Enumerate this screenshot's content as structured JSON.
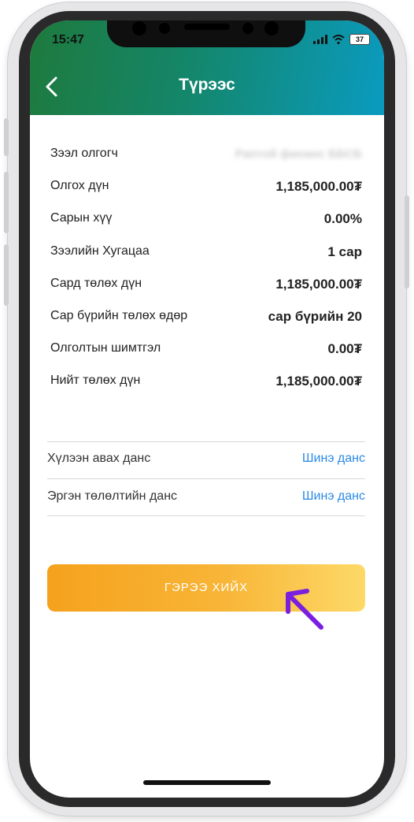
{
  "status_bar": {
    "time": "15:47",
    "battery": "37"
  },
  "header": {
    "title": "Түрээс",
    "back_icon": "chevron-left-icon"
  },
  "details": [
    {
      "label": "Зээл олгогч",
      "value": "Раптой финанс ББСБ",
      "blurred": true
    },
    {
      "label": "Олгох дүн",
      "value": "1,185,000.00₮"
    },
    {
      "label": "Сарын хүү",
      "value": "0.00%"
    },
    {
      "label": "Зээлийн Хугацаа",
      "value": "1 сар"
    },
    {
      "label": "Сард төлөх дүн",
      "value": "1,185,000.00₮"
    },
    {
      "label": "Сар бүрийн төлөх өдөр",
      "value": "сар бүрийн 20"
    },
    {
      "label": "Олголтын шимтгэл",
      "value": "0.00₮"
    },
    {
      "label": "Нийт төлөх дүн",
      "value": "1,185,000.00₮"
    }
  ],
  "accounts": [
    {
      "label": "Хүлээн авах данс",
      "link": "Шинэ данс"
    },
    {
      "label": "Эргэн төлөлтийн данс",
      "link": "Шинэ данс"
    }
  ],
  "cta": {
    "label": "ГЭРЭЭ ХИЙХ"
  },
  "colors": {
    "header_start": "#1e7a3d",
    "header_end": "#0a9bc0",
    "link": "#2a8be6",
    "cta_start": "#f5a21d",
    "cta_end": "#fdd967",
    "annotation_arrow": "#7a1fe0"
  }
}
